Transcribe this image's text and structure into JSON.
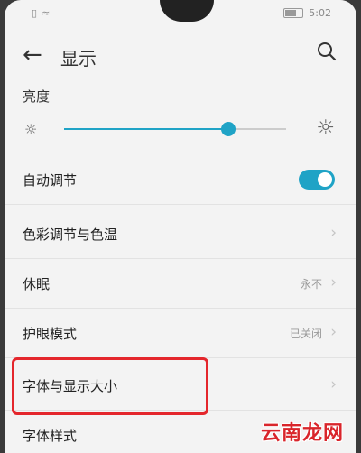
{
  "status": {
    "time": "5:02"
  },
  "header": {
    "title": "显示"
  },
  "brightness": {
    "label": "亮度",
    "level": 0.74
  },
  "rows": {
    "auto_adjust": {
      "label": "自动调节",
      "on": true
    },
    "color": {
      "label": "色彩调节与色温"
    },
    "sleep": {
      "label": "休眠",
      "value": "永不"
    },
    "eye": {
      "label": "护眼模式",
      "value": "已关闭"
    },
    "font_size": {
      "label": "字体与显示大小"
    },
    "font_style": {
      "label": "字体样式"
    }
  },
  "watermark": "云南龙网",
  "icons": {
    "back": "arrow-left-icon",
    "search": "search-icon",
    "sun_small": "sun-icon",
    "sun_large": "sun-icon",
    "chevron": "chevron-right-icon"
  },
  "colors": {
    "accent": "#1fa3c6",
    "highlight": "#e4262c"
  }
}
